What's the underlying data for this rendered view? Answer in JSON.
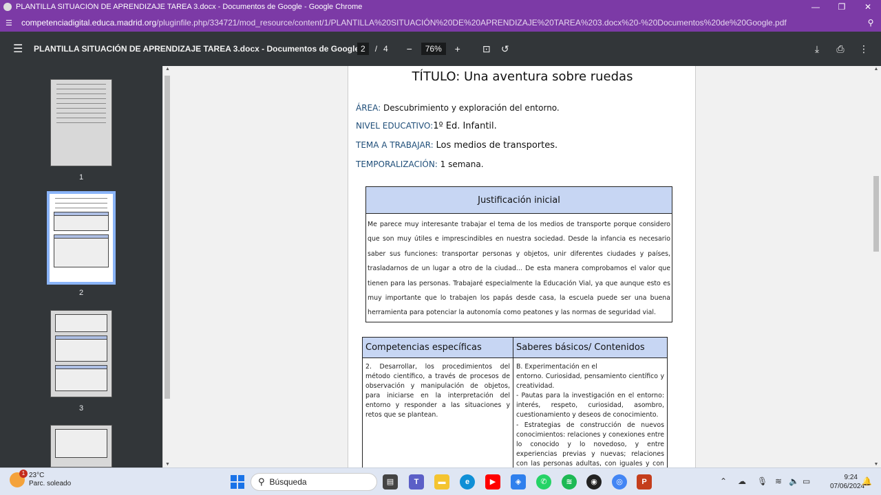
{
  "browser": {
    "window_title": "PLANTILLA SITUACIÓN DE APRENDIZAJE TAREA 3.docx - Documentos de Google - Google Chrome",
    "url_host": "competenciadigital.educa.madrid.org",
    "url_path": "/pluginfile.php/334721/mod_resource/content/1/PLANTILLA%20SITUACIÓN%20DE%20APRENDIZAJE%20TAREA%203.docx%20-%20Documentos%20de%20Google.pdf",
    "minimize": "—",
    "maximize": "❐",
    "close": "✕"
  },
  "pdf_toolbar": {
    "title": "PLANTILLA SITUACIÓN DE APRENDIZAJE TAREA 3.docx - Documentos de Google",
    "current_page": "2",
    "separator": "/",
    "total_pages": "4",
    "zoom": "76%",
    "icons": [
      "menu-icon",
      "zoom-out-icon",
      "zoom-in-icon",
      "fit-page-icon",
      "rotate-icon",
      "download-icon",
      "print-icon",
      "more-icon"
    ]
  },
  "thumbnails": [
    {
      "label": "1"
    },
    {
      "label": "2"
    },
    {
      "label": "3"
    },
    {
      "label": ""
    }
  ],
  "document": {
    "title": "TÍTULO: Una aventura sobre ruedas",
    "fields": [
      {
        "label": "ÁREA: ",
        "value": "Descubrimiento y exploración del entorno."
      },
      {
        "label": "NIVEL EDUCATIVO:",
        "value": "1º Ed. Infantil."
      },
      {
        "label": "TEMA A TRABAJAR: ",
        "value": "Los medios de transportes."
      },
      {
        "label": "TEMPORALIZACIÓN: ",
        "value": "1 semana."
      }
    ],
    "justification": {
      "heading": "Justificación inicial",
      "text": "Me parece muy interesante trabajar el tema de los medios de transporte porque considero que son muy útiles e imprescindibles en nuestra sociedad. Desde la infancia es necesario saber sus funciones: transportar personas y objetos, unir diferentes ciudades y países, trasladarnos de un lugar a otro de la ciudad... De esta manera comprobamos el valor que tienen para las personas.  Trabajaré especialmente la Educación Vial, ya que aunque esto es muy importante que lo trabajen los papás desde casa, la escuela puede ser una buena herramienta para potenciar la autonomía como peatones y las normas de seguridad vial."
    },
    "competencies": {
      "col1_header": "Competencias específicas",
      "col2_header": "Saberes básicos/ Contenidos",
      "col1_text": "2. Desarrollar, los procedimientos del método científico, a través de procesos de observación y manipulación de objetos, para iniciarse en la interpretación del entorno y responder a las situaciones y retos que se plantean.",
      "col2_lines": [
        "B. Experimentación en el",
        "entorno. Curiosidad, pensamiento científico y creatividad.",
        "- Pautas para la investigación en el entorno: interés, respeto, curiosidad, asombro, cuestionamiento y deseos de conocimiento.",
        "- Estrategias de construcción de nuevos conocimientos: relaciones y conexiones entre lo conocido y lo novedoso, y entre experiencias previas y nuevas; relaciones con las personas adultas, con iguales y con el"
      ]
    }
  },
  "taskbar": {
    "temperature": "23°C",
    "weather": "Parc. soleado",
    "weather_badge": "1",
    "search_placeholder": "Búsqueda",
    "time": "9:24",
    "date": "07/06/2024",
    "apps": [
      "start-icon",
      "file-explorer-icon",
      "teams-icon",
      "folder-icon",
      "edge-icon",
      "youtube-icon",
      "defender-icon",
      "whatsapp-icon",
      "spotify-icon",
      "obs-icon",
      "chrome-icon",
      "powerpoint-icon"
    ],
    "colors": {
      "accent": "#1a73e8",
      "chrome_purple": "#7c3aa6"
    }
  }
}
